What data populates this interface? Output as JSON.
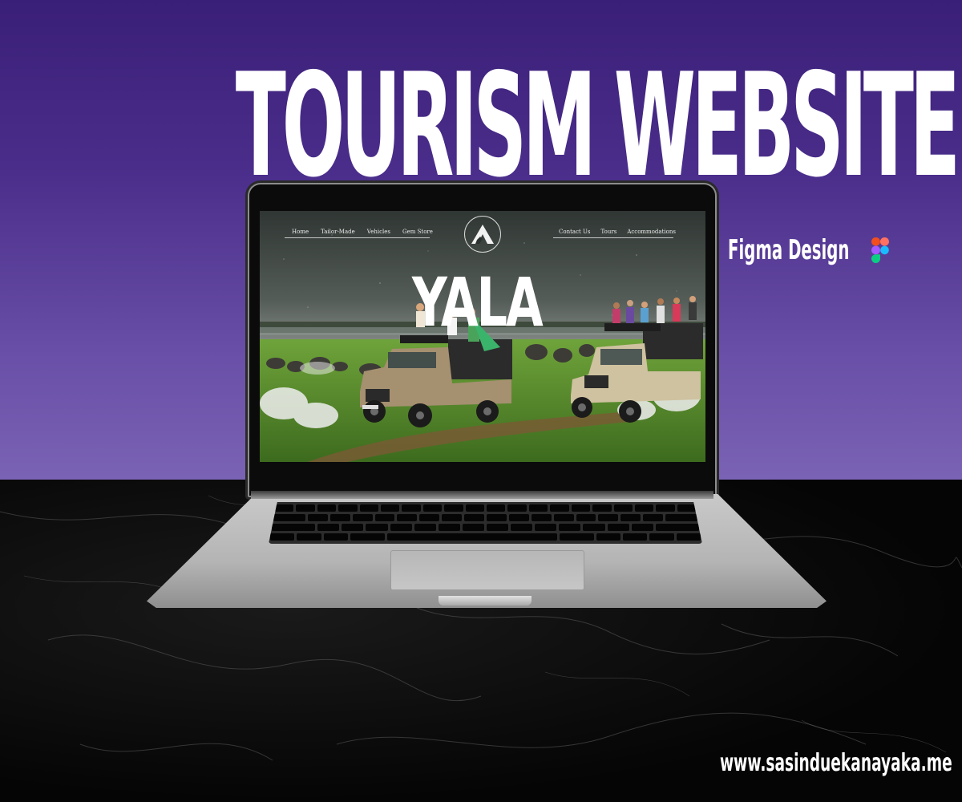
{
  "headline": "TOURISM WEBSITE",
  "badge": {
    "label": "Figma Design",
    "icon": "figma-icon"
  },
  "footer_url": "www.sasinduekanayaka.me",
  "website": {
    "nav_left": [
      "Home",
      "Tailor-Made",
      "Vehicles",
      "Gem Store"
    ],
    "nav_right": [
      "Contact Us",
      "Tours",
      "Accommodations"
    ],
    "logo_icon": "mountain-a-logo",
    "hero_title": "YALA"
  },
  "colors": {
    "purple_top": "#3a1f78",
    "purple_bottom": "#7a62b4",
    "marble": "#050505",
    "laptop_silver": "#c0c0c0",
    "grass": "#5e8f2e"
  }
}
